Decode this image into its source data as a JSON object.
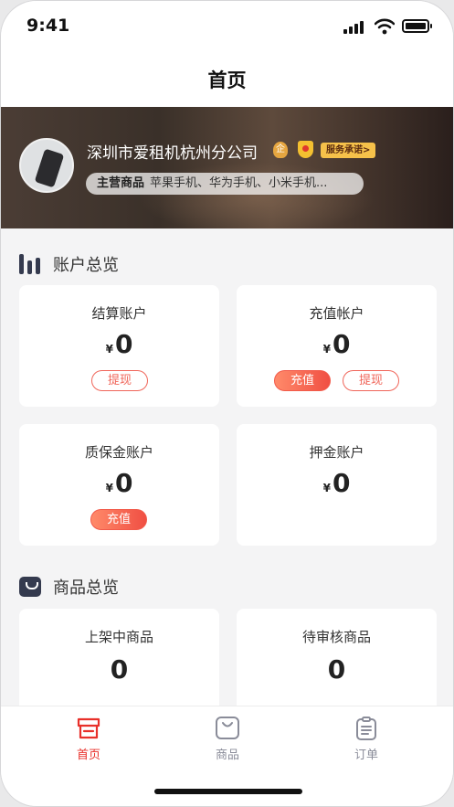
{
  "status": {
    "time": "9:41"
  },
  "nav": {
    "title": "首页"
  },
  "store": {
    "name": "深圳市爱租机杭州分公司",
    "qi_badge": "企",
    "service_badge": "服务承诺>",
    "main_goods_label": "主营商品",
    "main_goods_value": "苹果手机、华为手机、小米手机..."
  },
  "account": {
    "title": "账户总览",
    "cards": [
      {
        "label": "结算账户",
        "currency": "¥",
        "amount": "0",
        "btn1": "提现"
      },
      {
        "label": "充值帐户",
        "currency": "¥",
        "amount": "0",
        "btn1": "充值",
        "btn2": "提现"
      },
      {
        "label": "质保金账户",
        "currency": "¥",
        "amount": "0",
        "btn1": "充值"
      },
      {
        "label": "押金账户",
        "currency": "¥",
        "amount": "0"
      }
    ]
  },
  "goods": {
    "title": "商品总览",
    "cards": [
      {
        "label": "上架中商品",
        "count": "0"
      },
      {
        "label": "待审核商品",
        "count": "0"
      }
    ]
  },
  "tabs": [
    {
      "label": "首页",
      "icon": "store-icon",
      "active": true
    },
    {
      "label": "商品",
      "icon": "bag-icon",
      "active": false
    },
    {
      "label": "订单",
      "icon": "clipboard-icon",
      "active": false
    }
  ],
  "colors": {
    "accent": "#e8302a",
    "brand_gradient_start": "#ff8a6a",
    "brand_gradient_end": "#f04f43",
    "tab_inactive": "#8a8c99"
  }
}
